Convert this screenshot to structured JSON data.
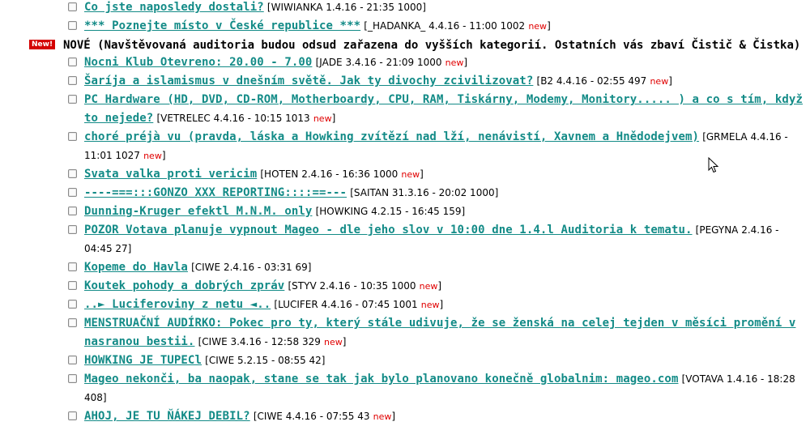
{
  "items_top": [
    {
      "title": "Co jste naposledy dostali?",
      "meta": "[WIWIANKA 1.4.16 - 21:35 1000]",
      "new": ""
    },
    {
      "title": "*** Poznejte místo v České republice ***",
      "meta": "[_HADANKA_ 4.4.16 - 11:00 1002",
      "new": "new",
      "tail": "]"
    }
  ],
  "section": {
    "badge": "New!",
    "title": "NOVÉ (Navštěvovaná auditoria budou odsud zařazena do vyšších kategorií. Ostatních vás zbaví Čistič & Čistka)"
  },
  "items": [
    {
      "title": "Nocni Klub Otevreno: 20.00 - 7.00",
      "meta": "[JADE 3.4.16 - 21:09 1000",
      "new": "new",
      "tail": "]"
    },
    {
      "title": "Šaríja a islamismus v dnešním světě. Jak ty divochy zcivilizovat?",
      "meta": "[B2 4.4.16 - 02:55 497",
      "new": "new",
      "tail": "]"
    },
    {
      "title": "PC Hardware (HD, DVD, CD-ROM, Motherboardy, CPU, RAM, Tiskárny, Modemy, Monitory..... ) a co s tím, když to nejede?",
      "meta": "[VETRELEC 4.4.16 - 10:15 1013",
      "new": "new",
      "tail": "]"
    },
    {
      "title": "choré préjà vu (pravda, láska a Howking zvítězí nad lží, nenávistí, Xavnem a Hnědodejvem)",
      "meta": "[GRMELA 4.4.16 - 11:01 1027",
      "new": "new",
      "tail": "]"
    },
    {
      "title": "Svata valka proti vericim",
      "meta": "[HOTEN 2.4.16 - 16:36 1000",
      "new": "new",
      "tail": "]"
    },
    {
      "title": "----===:::GONZO XXX REPORTING::::==---",
      "meta": "[SAITAN 31.3.16 - 20:02 1000]",
      "new": ""
    },
    {
      "title": "Dunning-Kruger efektl M.N.M. only",
      "meta": "[HOWKING 4.2.15 - 16:45 159]",
      "new": ""
    },
    {
      "title": "POZOR Votava planuje vypnout Mageo - dle jeho slov v 10:00 dne 1.4.l Auditoria k tematu.",
      "meta": "[PEGYNA 2.4.16 - 04:45 27]",
      "new": ""
    },
    {
      "title": "Kopeme do Havla",
      "meta": "[CIWE 2.4.16 - 03:31 69]",
      "new": ""
    },
    {
      "title": "Koutek pohody a dobrých zpráv",
      "meta": "[STYV 2.4.16 - 10:35 1000",
      "new": "new",
      "tail": "]"
    },
    {
      "title": "..► Luciferoviny z netu ◄..",
      "meta": "[LUCIFER 4.4.16 - 07:45 1001",
      "new": "new",
      "tail": "]"
    },
    {
      "title": "MENSTRUAČNÍ AUDÍRKO: Pokec pro ty, který stále udivuje, že se ženská na celej tejden v měsíci promění v nasranou bestii.",
      "meta": "[CIWE 3.4.16 - 12:58 329",
      "new": "new",
      "tail": "]"
    },
    {
      "title": "HOWKING JE TUPECl",
      "meta": "[CIWE 5.2.15 - 08:55 42]",
      "new": ""
    },
    {
      "title": "Mageo nekonči, ba naopak, stane se tak jak bylo planovano konečně globalnim: mageo.com",
      "meta": "[VOTAVA 1.4.16 - 18:28 408]",
      "new": ""
    },
    {
      "title": "AHOJ, JE TU ŇÁKEJ DEBIL?",
      "meta": "[CIWE 4.4.16 - 07:55 43",
      "new": "new",
      "tail": "]"
    }
  ],
  "colors": {
    "link": "#138b87",
    "new": "#e00000",
    "badge_bg": "#d40000"
  }
}
